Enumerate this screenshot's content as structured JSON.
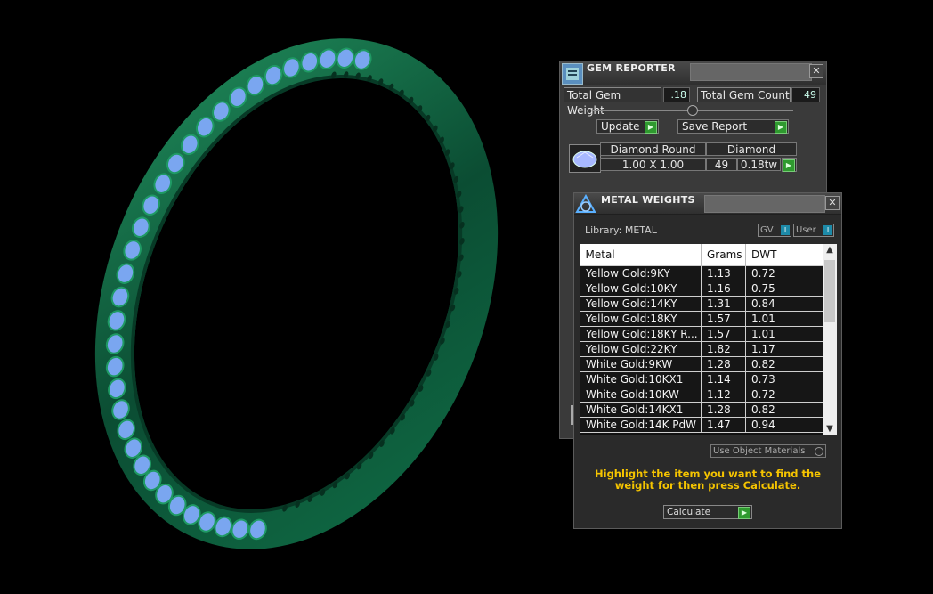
{
  "gem_reporter": {
    "title": "GEM REPORTER",
    "total_weight_label": "Total Gem Weight",
    "total_weight_value": ".18",
    "total_count_label": "Total Gem Count",
    "total_count_value": "49",
    "update_label": "Update",
    "save_report_label": "Save Report",
    "gem": {
      "name": "Diamond Round",
      "material": "Diamond",
      "size": "1.00 X 1.00",
      "count": "49",
      "weight": "0.18tw"
    }
  },
  "metal_weights": {
    "title": "METAL WEIGHTS",
    "library_label": "Library: METAL",
    "toggle_gv": "GV",
    "toggle_user": "User",
    "columns": [
      "Metal",
      "Grams",
      "DWT"
    ],
    "rows": [
      [
        "Yellow Gold:9KY",
        "1.13",
        "0.72"
      ],
      [
        "Yellow Gold:10KY",
        "1.16",
        "0.75"
      ],
      [
        "Yellow Gold:14KY",
        "1.31",
        "0.84"
      ],
      [
        "Yellow Gold:18KY",
        "1.57",
        "1.01"
      ],
      [
        "Yellow Gold:18KY R...",
        "1.57",
        "1.01"
      ],
      [
        "Yellow Gold:22KY",
        "1.82",
        "1.17"
      ],
      [
        "White Gold:9KW",
        "1.28",
        "0.82"
      ],
      [
        "White Gold:10KX1",
        "1.14",
        "0.73"
      ],
      [
        "White Gold:10KW",
        "1.12",
        "0.72"
      ],
      [
        "White Gold:14KX1",
        "1.28",
        "0.82"
      ],
      [
        "White Gold:14K PdW",
        "1.47",
        "0.94"
      ]
    ],
    "use_materials_label": "Use Object Materials",
    "hint": "Highlight the item you want to find the weight for then press Calculate.",
    "calculate_label": "Calculate"
  },
  "colors": {
    "ring": "#0d5c3c",
    "gems": "#7aa6f0",
    "hint": "#f5c400"
  }
}
